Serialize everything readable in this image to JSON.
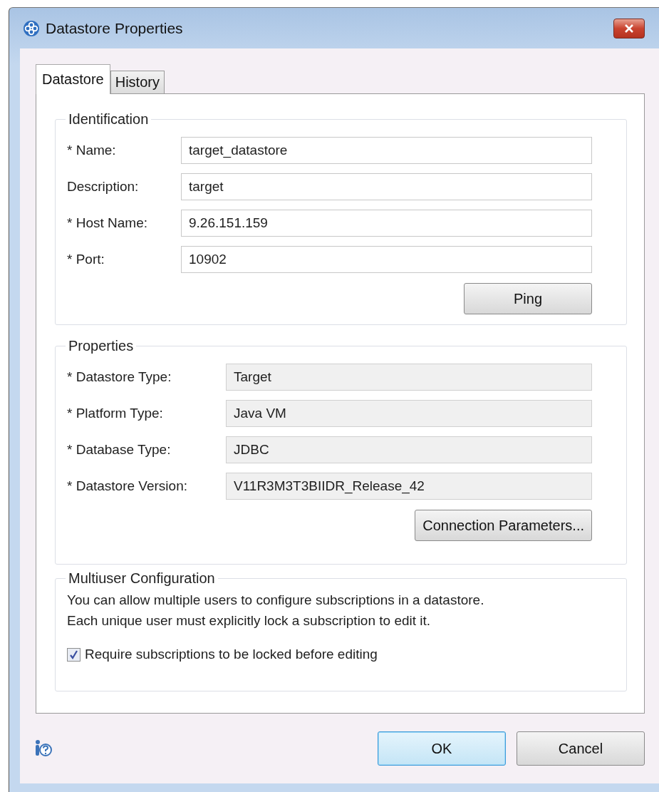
{
  "window": {
    "title": "Datastore Properties"
  },
  "tabs": [
    {
      "label": "Datastore",
      "selected": true
    },
    {
      "label": "History",
      "selected": false
    }
  ],
  "identification": {
    "title": "Identification",
    "fields": [
      {
        "label": "* Name:",
        "value": "target_datastore"
      },
      {
        "label": "Description:",
        "value": "target"
      },
      {
        "label": "* Host Name:",
        "value": "9.26.151.159"
      },
      {
        "label": "* Port:",
        "value": "10902"
      }
    ],
    "button": "Ping"
  },
  "properties": {
    "title": "Properties",
    "fields": [
      {
        "label": "* Datastore Type:",
        "value": "Target"
      },
      {
        "label": "* Platform Type:",
        "value": "Java VM"
      },
      {
        "label": "* Database Type:",
        "value": "JDBC"
      },
      {
        "label": "* Datastore Version:",
        "value": "V11R3M3T3BIIDR_Release_42"
      }
    ],
    "button": "Connection Parameters..."
  },
  "multiuser": {
    "title": "Multiuser Configuration",
    "description_lines": [
      "You can allow multiple users to configure subscriptions in a datastore.",
      "Each unique user must explicitly lock a subscription to edit it."
    ],
    "checkbox": {
      "label": "Require subscriptions to be locked before editing",
      "checked": true
    }
  },
  "buttons": [
    {
      "label": "OK",
      "default": true
    },
    {
      "label": "Cancel",
      "default": false
    }
  ]
}
